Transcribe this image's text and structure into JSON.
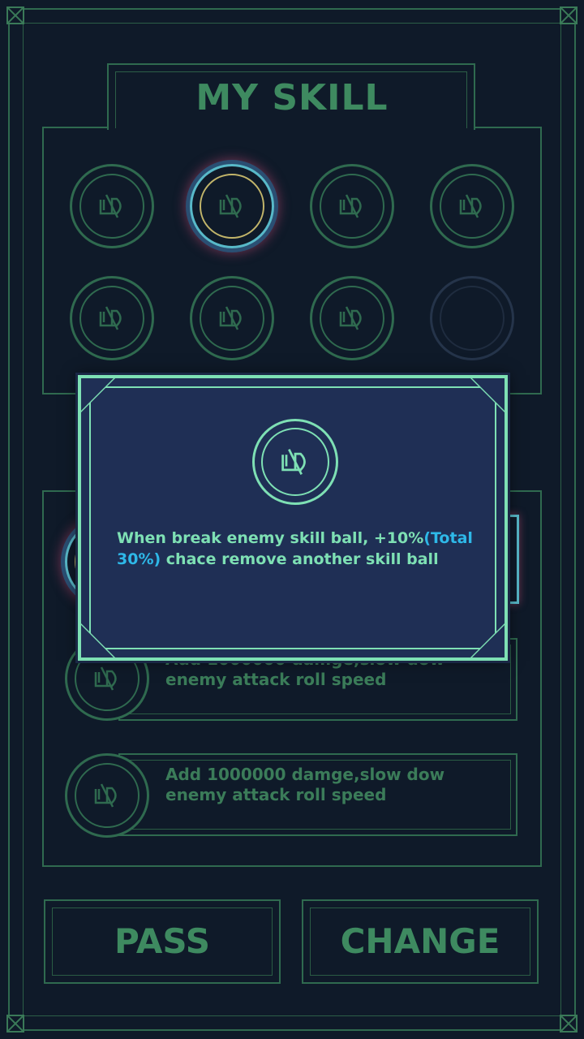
{
  "title": "MY SKILL",
  "skills": [
    {
      "state": "owned"
    },
    {
      "state": "selected"
    },
    {
      "state": "owned"
    },
    {
      "state": "owned"
    },
    {
      "state": "owned"
    },
    {
      "state": "owned"
    },
    {
      "state": "owned"
    },
    {
      "state": "empty"
    }
  ],
  "skill_cards": [
    {
      "description": "Add 1000000 damge,slow dow enemy attack roll speed"
    },
    {
      "description": "Add 1000000 damge,slow dow enemy attack roll speed"
    }
  ],
  "popup": {
    "desc_main": "When break enemy skill ball, +10%",
    "desc_highlight": "(Total 30%)",
    "desc_tail": " chace remove another skill ball"
  },
  "buttons": {
    "pass": "PASS",
    "change": "CHANGE"
  },
  "colors": {
    "frame": "#2f6a4f",
    "title": "#3e8a60",
    "popup_bg": "#1f2f55",
    "popup_accent": "#7ee0b4",
    "highlight": "#2eb8e8",
    "selected_glow": "#b4466e"
  },
  "icons": {
    "skill": "skill-glyph-icon"
  }
}
